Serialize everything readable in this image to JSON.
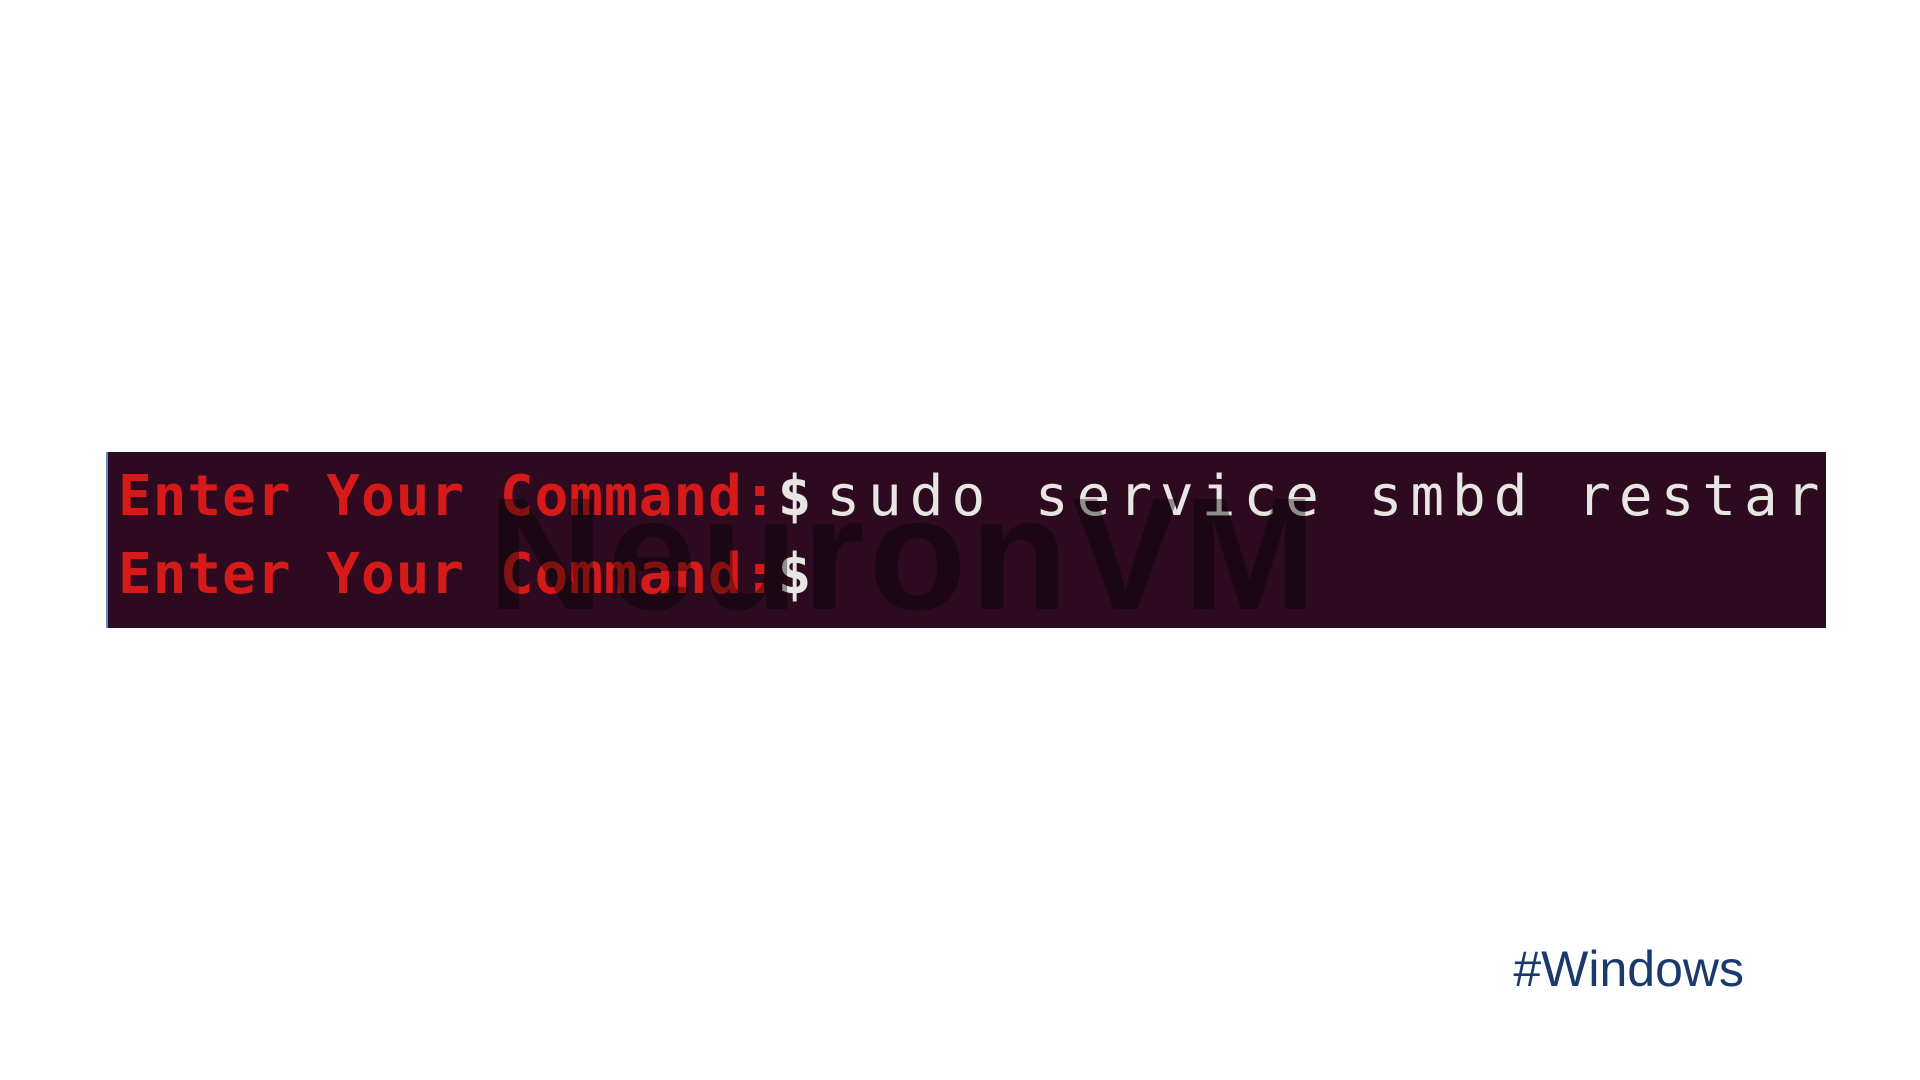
{
  "terminal": {
    "watermark": "NeuronVM",
    "lines": [
      {
        "prompt": "Enter Your Command:",
        "dollar": "$",
        "command": "sudo service smbd restart"
      },
      {
        "prompt": "Enter Your Command:",
        "dollar": "$",
        "command": ""
      }
    ]
  },
  "hashtag": "#Windows",
  "colors": {
    "terminal_bg": "#2d0a1f",
    "prompt_red": "#d61a1a",
    "text_white": "#e8e6e3",
    "hashtag_blue": "#1a3a6e"
  }
}
